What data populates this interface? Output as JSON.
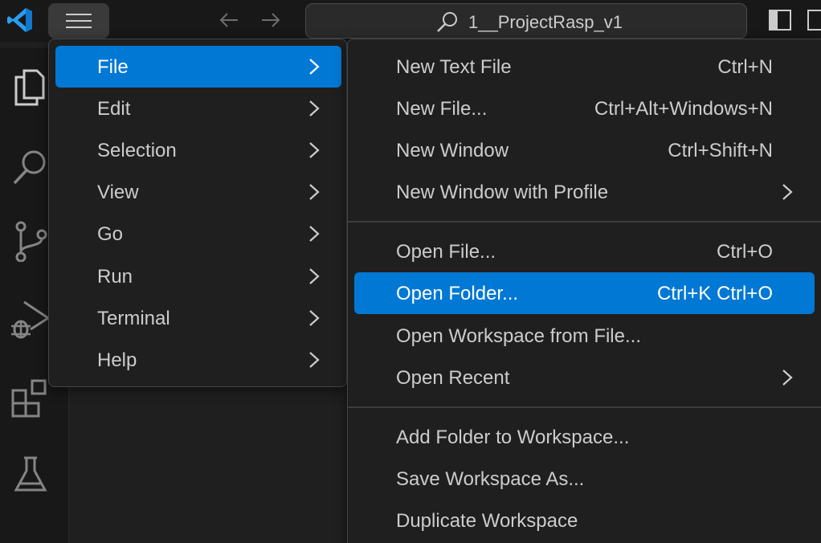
{
  "titlebar": {
    "project_title": "1__ProjectRasp_v1",
    "icons": [
      "vscode-logo",
      "menu-icon",
      "arrow-left-icon",
      "arrow-right-icon",
      "search-icon",
      "layout-sidebar-icon"
    ]
  },
  "activity_bar": {
    "items": [
      "explorer-icon",
      "search-icon",
      "source-control-icon",
      "run-debug-icon",
      "extensions-icon",
      "testing-icon"
    ]
  },
  "main_menu": {
    "items": [
      {
        "label": "File",
        "active": true
      },
      {
        "label": "Edit"
      },
      {
        "label": "Selection"
      },
      {
        "label": "View"
      },
      {
        "label": "Go"
      },
      {
        "label": "Run"
      },
      {
        "label": "Terminal"
      },
      {
        "label": "Help"
      }
    ]
  },
  "file_menu": {
    "items": [
      {
        "label": "New Text File",
        "shortcut": "Ctrl+N"
      },
      {
        "label": "New File...",
        "shortcut": "Ctrl+Alt+Windows+N"
      },
      {
        "label": "New Window",
        "shortcut": "Ctrl+Shift+N"
      },
      {
        "label": "New Window with Profile",
        "shortcut": ""
      },
      {
        "label": "Open File...",
        "shortcut": "Ctrl+O"
      },
      {
        "label": "Open Folder...",
        "shortcut": "Ctrl+K Ctrl+O"
      },
      {
        "label": "Open Workspace from File...",
        "shortcut": ""
      },
      {
        "label": "Open Recent",
        "shortcut": ""
      },
      {
        "label": "Add Folder to Workspace...",
        "shortcut": ""
      },
      {
        "label": "Save Workspace As...",
        "shortcut": ""
      },
      {
        "label": "Duplicate Workspace",
        "shortcut": ""
      }
    ]
  },
  "colors": {
    "accent": "#0078d4",
    "background": "#1f1f1f",
    "titlebar": "#181818",
    "text": "#cccccc"
  }
}
